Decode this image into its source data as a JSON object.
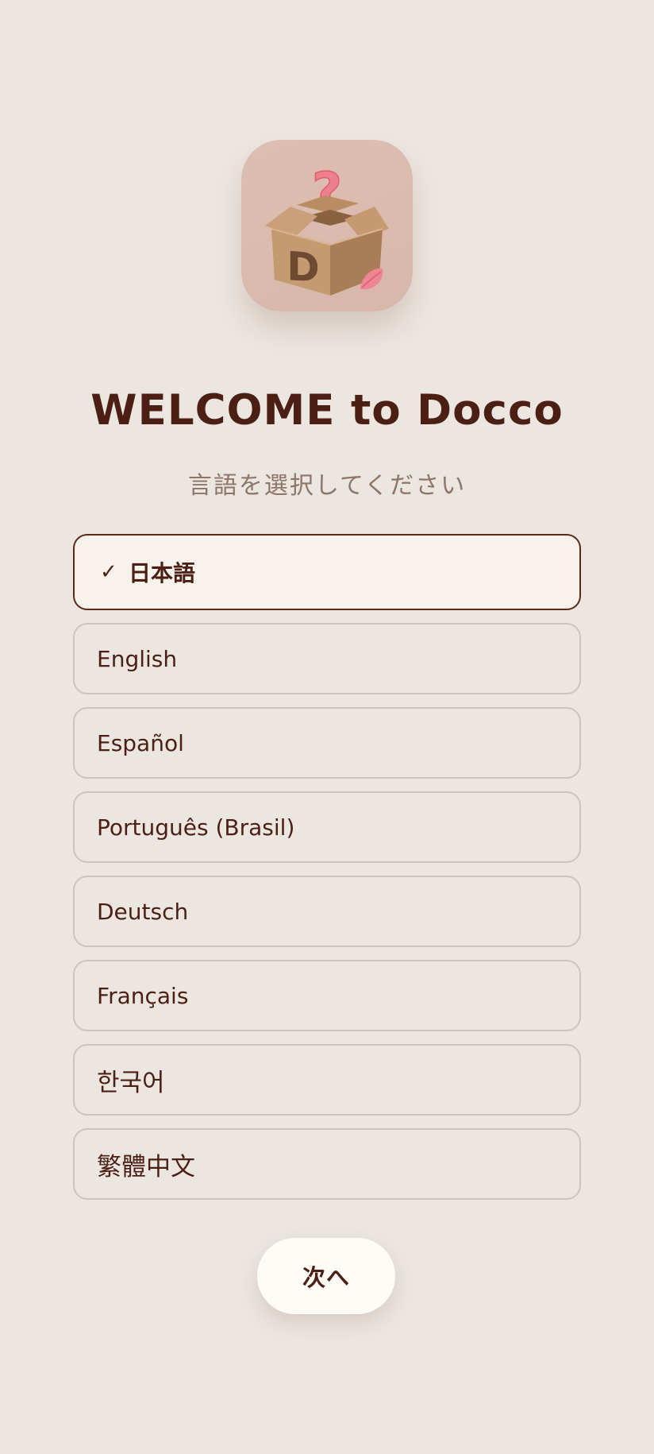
{
  "app": {
    "icon_name": "docco-box-question-icon",
    "icon_letter": "D"
  },
  "header": {
    "title": "WELCOME to Docco",
    "subtitle": "言語を選択してください"
  },
  "language_options": [
    {
      "label": "日本語",
      "selected": true
    },
    {
      "label": "English",
      "selected": false
    },
    {
      "label": "Español",
      "selected": false
    },
    {
      "label": "Português (Brasil)",
      "selected": false
    },
    {
      "label": "Deutsch",
      "selected": false
    },
    {
      "label": "Français",
      "selected": false
    },
    {
      "label": "한국어",
      "selected": false
    },
    {
      "label": "繁體中文",
      "selected": false
    }
  ],
  "selected_marker": "✓",
  "next_button": {
    "label": "次へ"
  },
  "colors": {
    "background": "#ece6e0",
    "text_primary": "#4b1f14",
    "text_secondary": "#8d7567",
    "selected_bg": "#f7f2ec",
    "selected_border": "#5a2a1d",
    "option_border": "#cbc4bf",
    "icon_bg": "#d8b7aa",
    "accent_pink": "#ee7a86"
  }
}
